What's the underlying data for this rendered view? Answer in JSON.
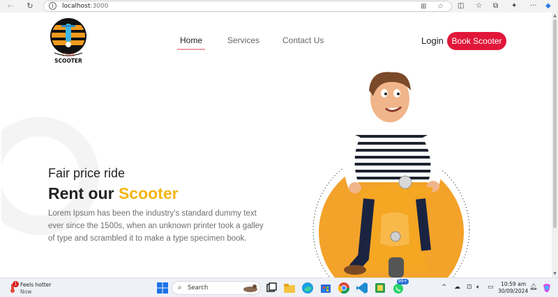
{
  "browser": {
    "url_host": "localhost",
    "url_port": ":3000"
  },
  "logo": {
    "script_text": "Cash",
    "brand_text": "SCOOTER"
  },
  "nav": {
    "items": [
      {
        "label": "Home",
        "active": true
      },
      {
        "label": "Services",
        "active": false
      },
      {
        "label": "Contact Us",
        "active": false
      }
    ],
    "login_label": "Login",
    "cta_label": "Book Scooter"
  },
  "hero": {
    "subtitle": "Fair price ride",
    "title_prefix": "Rent our ",
    "title_accent": "Scooter",
    "description": "Lorem Ipsum has been the industry's standard dummy text ever since the 1500s, when an unknown printer took a galley of type and scrambled it to make a type specimen book."
  },
  "colors": {
    "accent_red": "#e1173a",
    "accent_yellow": "#f4b413",
    "scooter_orange": "#f19a1e"
  },
  "taskbar": {
    "weather_title": "Feels hotter",
    "weather_sub": "Now",
    "weather_badge": "1",
    "search_label": "Search",
    "whatsapp_badge": "99+",
    "time": "10:59 am",
    "date": "30/09/2024"
  }
}
